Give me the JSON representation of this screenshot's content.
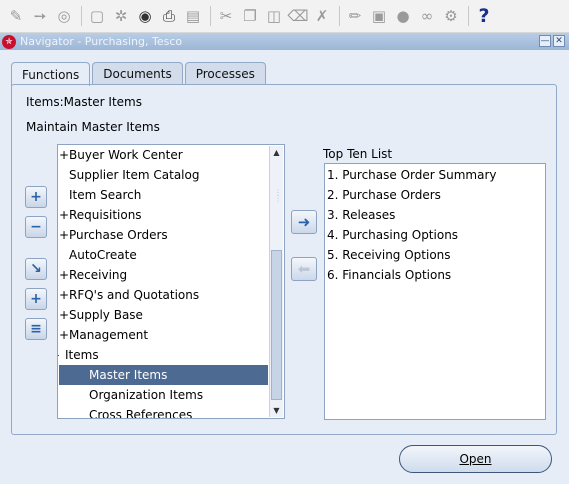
{
  "toolbar": {
    "icons": [
      "new-icon",
      "cursor-icon",
      "eyeglasses-icon",
      "notepad-icon",
      "tree-icon",
      "fingerprint-icon",
      "print-icon",
      "folder-icon",
      "cut-icon",
      "copy-icon",
      "paste-icon",
      "clear-icon",
      "delete-icon",
      "edit-icon",
      "zoom-icon",
      "globe-icon",
      "attach-icon",
      "tools-icon",
      "help-icon"
    ],
    "help_label": "?"
  },
  "window": {
    "title": "Navigator - Purchasing, Tesco",
    "minimize_glyph": "—",
    "close_glyph": "✕"
  },
  "tabs": [
    {
      "label": "Functions",
      "active": true
    },
    {
      "label": "Documents",
      "active": false
    },
    {
      "label": "Processes",
      "active": false
    }
  ],
  "breadcrumb": "Items:Master Items",
  "heading": "Maintain Master Items",
  "tree": {
    "items": [
      {
        "expander": "+",
        "label": "Buyer Work Center",
        "indent": 0
      },
      {
        "expander": "",
        "label": "Supplier Item Catalog",
        "indent": 0
      },
      {
        "expander": "",
        "label": "Item Search",
        "indent": 0
      },
      {
        "expander": "+",
        "label": "Requisitions",
        "indent": 0
      },
      {
        "expander": "+",
        "label": "Purchase Orders",
        "indent": 0
      },
      {
        "expander": "",
        "label": "AutoCreate",
        "indent": 0
      },
      {
        "expander": "+",
        "label": "Receiving",
        "indent": 0
      },
      {
        "expander": "+",
        "label": "RFQ's and Quotations",
        "indent": 0
      },
      {
        "expander": "+",
        "label": "Supply Base",
        "indent": 0
      },
      {
        "expander": "+",
        "label": "Management",
        "indent": 0
      },
      {
        "expander": "-",
        "label": "Items",
        "indent": 0
      },
      {
        "expander": "",
        "label": "Master Items",
        "indent": 1,
        "selected": true
      },
      {
        "expander": "",
        "label": "Organization Items",
        "indent": 1
      },
      {
        "expander": "",
        "label": "Cross References",
        "indent": 1
      }
    ]
  },
  "side_buttons": {
    "expand": "+",
    "collapse": "−",
    "expand_branch": "↘",
    "expand_all": "+",
    "collapse_all": "≡"
  },
  "top_ten": {
    "label": "Top Ten List",
    "items": [
      "1. Purchase Order Summary",
      "2. Purchase Orders",
      "3. Releases",
      "4. Purchasing Options",
      "5. Receiving Options",
      "6. Financials Options"
    ]
  },
  "move_buttons": {
    "add": "➜",
    "remove": "⬅"
  },
  "open_button": {
    "label": "Open"
  }
}
